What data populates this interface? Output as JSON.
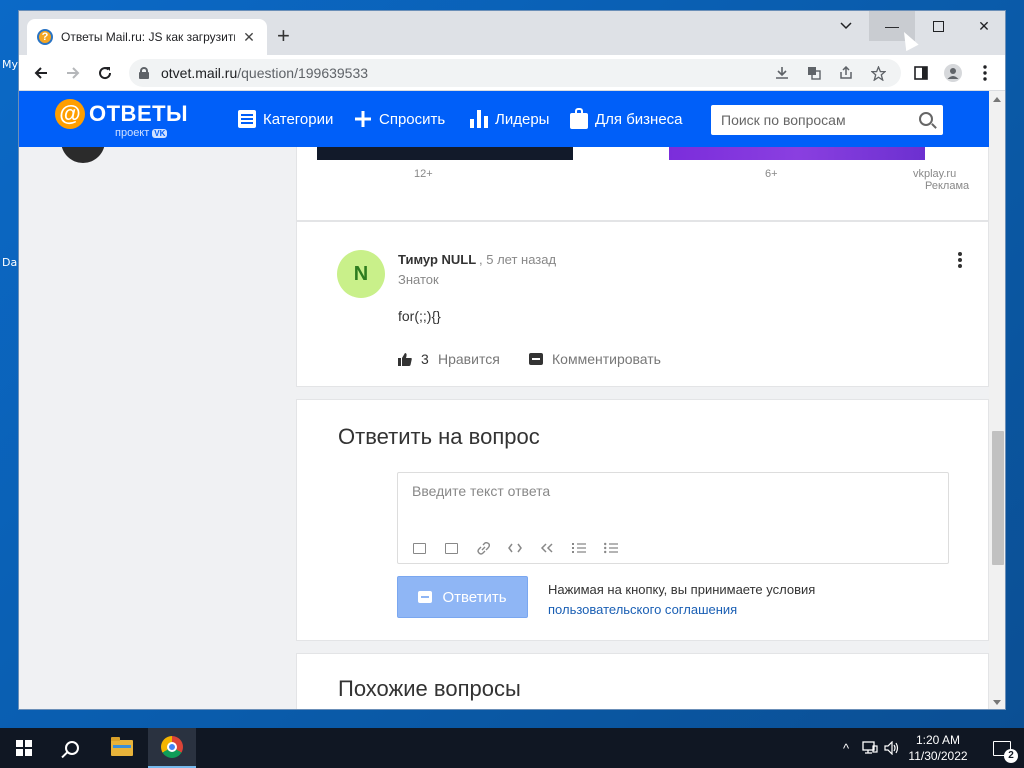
{
  "desktop": {
    "icon_fragments": [
      "My",
      "Da"
    ]
  },
  "browser": {
    "tab_title": "Ответы Mail.ru: JS как загрузить",
    "tab_favicon": "?",
    "tab_close": "✕",
    "new_tab": "+",
    "url_host": "otvet.mail.ru",
    "url_path": "/question/199639533",
    "minimize": "—",
    "close": "✕",
    "chevron": "⌄"
  },
  "site": {
    "logo_at": "@",
    "logo_text": "ОТВЕТЫ",
    "logo_sub": "проект",
    "logo_sub_badge": "VK",
    "nav": {
      "categories": "Категории",
      "ask": "Спросить",
      "leaders": "Лидеры",
      "business": "Для бизнеса"
    },
    "search_placeholder": "Поиск по вопросам",
    "accent": "#005ff9",
    "logo_accent": "#ff9e00"
  },
  "ad": {
    "age1": "12+",
    "age2": "6+",
    "source": "vkplay.ru",
    "label": "Реклама"
  },
  "answer": {
    "avatar_letter": "N",
    "author": "Тимур NULL",
    "time": ", 5 лет назад",
    "rank": "Знаток",
    "text": "for(;;){}",
    "likes": "3",
    "like_label": "Нравится",
    "comment_label": "Комментировать"
  },
  "reply": {
    "title": "Ответить на вопрос",
    "placeholder": "Введите текст ответа",
    "button": "Ответить",
    "terms_text": "Нажимая на кнопку, вы принимаете условия",
    "terms_link": "пользовательского соглашения",
    "toolbar_icons": [
      "image-icon",
      "video-icon",
      "link-icon",
      "code-icon",
      "quote-icon",
      "ordered-list-icon",
      "bullet-list-icon"
    ]
  },
  "similar": {
    "title": "Похожие вопросы"
  },
  "taskbar": {
    "time": "1:20 AM",
    "date": "11/30/2022",
    "notifications": "2",
    "tray_chevron": "^"
  }
}
